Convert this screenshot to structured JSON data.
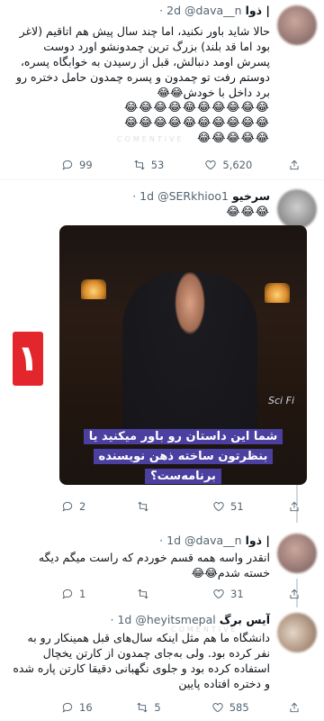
{
  "badge": {
    "label": "١"
  },
  "watermark": "COMENTIVE",
  "tweets": [
    {
      "name": "ذوا |",
      "handle": "@dava__n",
      "time": "· 2d",
      "text": "حالا شاید باور نکنید، اما چند سال پیش هم اتاقیم (لاغر بود اما قد بلند) بزرگ ترین چمدونشو اورد دوست پسرش اومد دنبالش، قبل از رسیدن به خوابگاه پسره، دوستم رفت تو چمدون و پسره چمدون حامل دختره رو برد داخل با خودش😂😂",
      "emoji_rows": [
        "😂😂😂😂😂😂😂😂😂😂",
        "😂😂😂😂😂😂😂😂😂😂",
        "😂😂😂😂😂"
      ],
      "replies": "99",
      "retweets": "53",
      "likes": "5,620"
    },
    {
      "name": "سرخیو",
      "handle": "@SERkhioo1",
      "time": "· 1d",
      "text": "😂😂😂",
      "media_caption_line1": "شما این داستان رو باور میکنید یا",
      "media_caption_line2": "بنظرتون ساخته ذهن نویسنده برنامه‌ست؟",
      "media_logo": "Sci Fi",
      "replies": "2",
      "retweets": "",
      "likes": "51"
    },
    {
      "name": "ذوا |",
      "handle": "@dava__n",
      "time": "· 1d",
      "text": "انقدر واسه همه قسم خوردم که راست میگم دیگه خسته شدم😂😂",
      "replies": "1",
      "retweets": "",
      "likes": "31"
    },
    {
      "name": "آیس برگ",
      "handle": "@heyitsmepal",
      "time": "· 1d",
      "text": "دانشگاه ما هم مثل اینکه سال‌های قبل همینکار رو به نفر کرده بود. ولی به‌جای چمدون از کارتن یخچال استفاده کرده بود و جلوی نگهبانی دقیقا کارتن پاره شده و دختره افتاده پایین",
      "replies": "16",
      "retweets": "5",
      "likes": "585"
    }
  ]
}
